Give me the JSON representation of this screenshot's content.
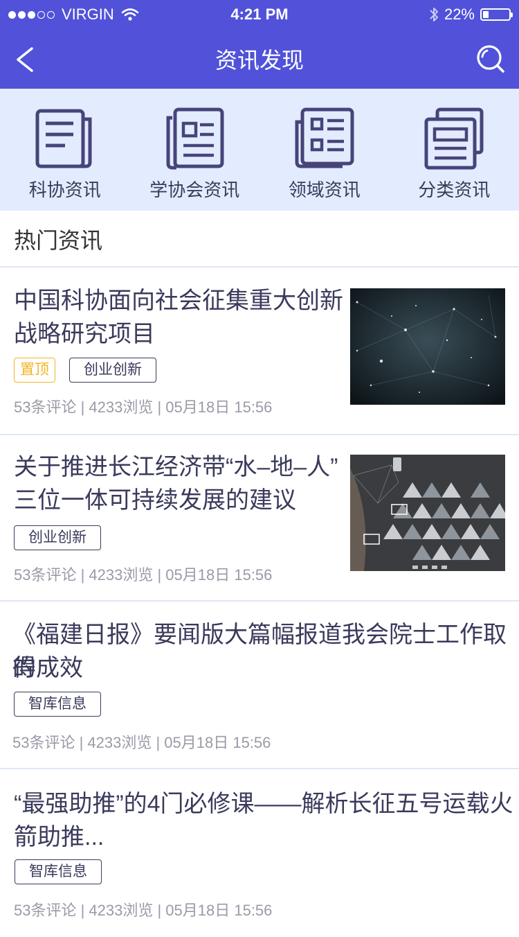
{
  "status_bar": {
    "carrier": "VIRGIN",
    "time": "4:21 PM",
    "battery": "22%",
    "battery_level": 0.22
  },
  "nav": {
    "title": "资讯发现"
  },
  "categories": [
    {
      "label": "科协资讯",
      "icon": "newspaper-icon"
    },
    {
      "label": "学协会资讯",
      "icon": "magazine-icon"
    },
    {
      "label": "领域资讯",
      "icon": "news-list-icon"
    },
    {
      "label": "分类资讯",
      "icon": "stacked-news-icon"
    }
  ],
  "section": {
    "title": "热门资讯"
  },
  "articles": [
    {
      "title_line1": "中国科协面向社会征集重大创新",
      "title_line2": "战略研究项目",
      "tags": [
        "置顶",
        "创业创新"
      ],
      "meta": "53条评论 | 4233浏览 | 05月18日 15:56",
      "thumbnail": "network-starfield-image"
    },
    {
      "title_line1": "关于推进长江经济带“水–地–人”",
      "title_line2": "三位一体可持续发展的建议",
      "tags": [
        "创业创新"
      ],
      "meta": "53条评论 | 4233浏览 | 05月18日 15:56",
      "thumbnail": "triangle-icons-image"
    },
    {
      "title_line1": "《福建日报》要闻版大篇幅报道我会院士工作取得",
      "title_line2": "的成效",
      "tags": [
        "智库信息"
      ],
      "meta": "53条评论 | 4233浏览 | 05月18日 15:56"
    },
    {
      "title_line1": "“最强助推”的4门必修课——解析长征五号运载火",
      "title_line2": "箭助推...",
      "tags": [
        "智库信息"
      ],
      "meta": "53条评论 | 4233浏览 | 05月18日 15:56"
    }
  ]
}
